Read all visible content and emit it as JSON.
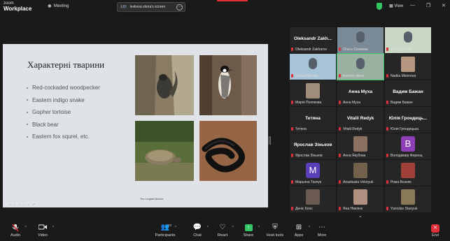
{
  "app": {
    "brand_top": "zoom",
    "brand_bottom": "Workplace",
    "meeting_label": "Meeting"
  },
  "share_pill": {
    "badge": "LO",
    "text": "leskova olena's screen",
    "more": "···"
  },
  "titlebar_right": {
    "view_label": "View",
    "minimize": "—",
    "restore": "❐",
    "close": "✕"
  },
  "slide": {
    "title": "Характерні тварини",
    "bullets": [
      "Red-cockaded woodpecker",
      "Eastern indigo snake",
      "Gopher tortoise",
      "Black bear",
      "Eastern fox squrel, etc."
    ],
    "caption": "The Longleaf Alliance",
    "footer": "• • • • • ↗"
  },
  "participants": [
    {
      "display": "Oleksandr Zakh...",
      "name": "Oleksandr Zakharov",
      "type": "name"
    },
    {
      "display": "",
      "name": "Ольга Єрємова",
      "type": "video",
      "color": "#7a8a96"
    },
    {
      "display": "",
      "name": "Ecology Host",
      "type": "video",
      "color": "#c8d8c4"
    },
    {
      "display": "",
      "name": "Олена Матюк",
      "type": "video",
      "color": "#a8c4d8"
    },
    {
      "display": "",
      "name": "leskova olena",
      "type": "video",
      "color": "#9ab0a0",
      "active": true
    },
    {
      "display": "",
      "name": "Nadiia Mironova",
      "type": "photo",
      "color": "#b59680"
    },
    {
      "display": "",
      "name": "Марія Полякова",
      "type": "photo",
      "color": "#a08c7a"
    },
    {
      "display": "Анна Муха",
      "name": "Анна Муха",
      "type": "name"
    },
    {
      "display": "Вадим Бажан",
      "name": "Вадим Бажан",
      "type": "name"
    },
    {
      "display": "Тетяна",
      "name": "Тетяна",
      "type": "name"
    },
    {
      "display": "Vitalii Redyk",
      "name": "Vitalii Redyk",
      "type": "name"
    },
    {
      "display": "Юлія Грондець...",
      "name": "Юлія Грондецька",
      "type": "name"
    },
    {
      "display": "Ярослав Зіньков",
      "name": "Ярослав Зіньков",
      "type": "name"
    },
    {
      "display": "",
      "name": "Анна Якубова",
      "type": "photo",
      "color": "#8a7060"
    },
    {
      "display": "B",
      "name": "Володимир Ференц",
      "type": "letter",
      "color": "#8e3fb8"
    },
    {
      "display": "M",
      "name": "Марьяна Ткачук",
      "type": "letter",
      "color": "#5a3fb8"
    },
    {
      "display": "",
      "name": "Anastasiia Volotyuk",
      "type": "photo",
      "color": "#70604c"
    },
    {
      "display": "",
      "name": "Рома Возняк",
      "type": "photo",
      "color": "#a04038"
    },
    {
      "display": "",
      "name": "Деніс Кенс",
      "type": "photo",
      "color": "#6a5a50"
    },
    {
      "display": "",
      "name": "Яна Никлюк",
      "type": "photo",
      "color": "#b09080"
    },
    {
      "display": "",
      "name": "Yaroslav Stasyuk",
      "type": "photo",
      "color": "#8a7a5a"
    }
  ],
  "toolbar": {
    "audio": "Audio",
    "video": "Video",
    "participants": "Participants",
    "participants_count": "23",
    "chat": "Chat",
    "react": "React",
    "share": "Share",
    "host_tools": "Host tools",
    "apps": "Apps",
    "more": "More",
    "end": "End",
    "scroll_more": "⌄"
  }
}
